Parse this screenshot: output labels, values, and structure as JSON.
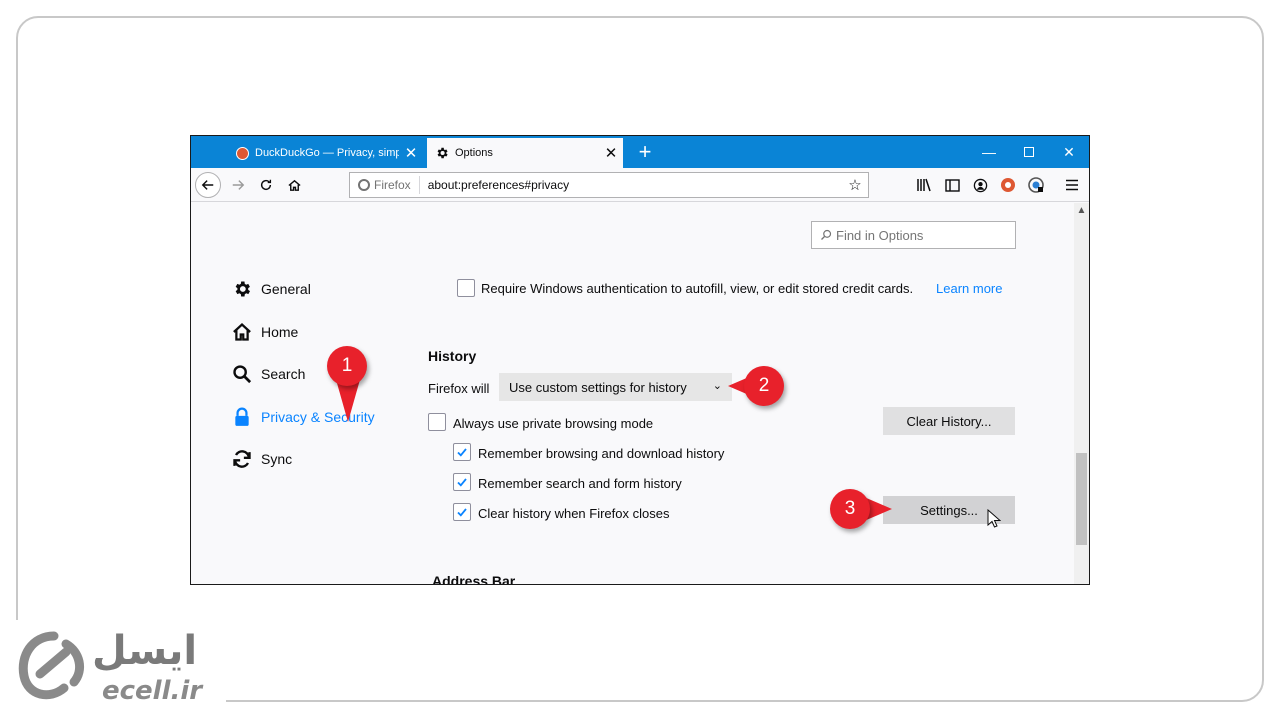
{
  "browser": {
    "tabs": [
      {
        "label": "DuckDuckGo — Privacy, simpli",
        "active": false
      },
      {
        "label": "Options",
        "active": true
      }
    ],
    "url_identity": "Firefox",
    "url": "about:preferences#privacy"
  },
  "search": {
    "placeholder": "Find in Options"
  },
  "sidebar": {
    "items": [
      {
        "label": "General",
        "icon": "gear-icon"
      },
      {
        "label": "Home",
        "icon": "home-icon"
      },
      {
        "label": "Search",
        "icon": "search-icon"
      },
      {
        "label": "Privacy & Security",
        "icon": "lock-icon",
        "selected": true
      },
      {
        "label": "Sync",
        "icon": "sync-icon"
      }
    ]
  },
  "main": {
    "auth_checkbox_label": "Require Windows authentication to autofill, view, or edit stored credit cards.",
    "learn_more": "Learn more",
    "history_heading": "History",
    "firefox_will_label": "Firefox will",
    "history_mode": "Use custom settings for history",
    "private_mode_label": "Always use private browsing mode",
    "clear_history_button": "Clear History...",
    "remember_browsing_label": "Remember browsing and download history",
    "remember_search_label": "Remember search and form history",
    "clear_on_close_label": "Clear history when Firefox closes",
    "settings_button": "Settings...",
    "address_bar_heading": "Address Bar"
  },
  "annotations": {
    "marker_1": "1",
    "marker_2": "2",
    "marker_3": "3",
    "color": "#e8212b"
  },
  "logo": {
    "persian": "ایسل",
    "latin": "ecell.ir"
  },
  "colors": {
    "titlebar": "#0a84d6",
    "accent": "#0a84ff"
  }
}
